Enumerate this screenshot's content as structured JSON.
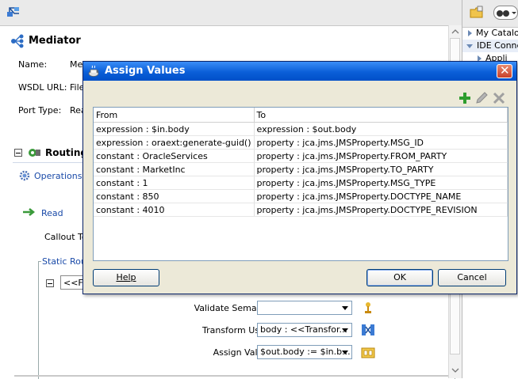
{
  "mediator": {
    "title": "Mediator",
    "name_label": "Name:",
    "name_value": "Me",
    "wsdl_label": "WSDL URL:",
    "wsdl_value": "File",
    "port_type_label": "Port Type:",
    "port_type_value": "Rea"
  },
  "routing": {
    "title": "Routing",
    "operations_link": "Operations",
    "read_link": "Read",
    "callout_label": "Callout To",
    "static_routing_legend": "Static Rou",
    "filter_value": "<<Fil"
  },
  "form": {
    "validate_semantic_label": "Validate Semantic",
    "validate_semantic_value": "",
    "transform_using_label": "Transform Using",
    "transform_using_value": "body : <<Transfor...",
    "assign_values_label": "Assign Values",
    "assign_values_value": "$out.body := $in.b..."
  },
  "right_panel": {
    "items": [
      {
        "label": "My Catalog",
        "expander": "collapsed"
      },
      {
        "label": "IDE Conne",
        "expander": "collapsed"
      },
      {
        "label": "Appli",
        "expander": "open"
      }
    ]
  },
  "dialog": {
    "title": "Assign Values",
    "close_glyph": "✕",
    "table": {
      "columns": [
        "From",
        "To"
      ],
      "rows": [
        {
          "from": "expression : $in.body",
          "to": "expression : $out.body"
        },
        {
          "from": "expression : oraext:generate-guid()",
          "to": "property : jca.jms.JMSProperty.MSG_ID"
        },
        {
          "from": "constant : OracleServices",
          "to": "property : jca.jms.JMSProperty.FROM_PARTY"
        },
        {
          "from": "constant : MarketInc",
          "to": "property : jca.jms.JMSProperty.TO_PARTY"
        },
        {
          "from": "constant : 1",
          "to": "property : jca.jms.JMSProperty.MSG_TYPE"
        },
        {
          "from": "constant : 850",
          "to": "property : jca.jms.JMSProperty.DOCTYPE_NAME"
        },
        {
          "from": "constant : 4010",
          "to": "property : jca.jms.JMSProperty.DOCTYPE_REVISION"
        }
      ]
    },
    "help_label": "Help",
    "ok_label": "OK",
    "cancel_label": "Cancel"
  },
  "icons": {
    "add": "add-icon",
    "edit": "pencil-icon",
    "delete": "delete-icon",
    "transform": "transform-icon",
    "assign": "assign-icon",
    "validate": "validate-icon"
  },
  "colors": {
    "title_bar": "#0a5ed8",
    "link": "#1a4aa8",
    "dialog_bg": "#ece9d8",
    "close_button": "#c9402a"
  }
}
